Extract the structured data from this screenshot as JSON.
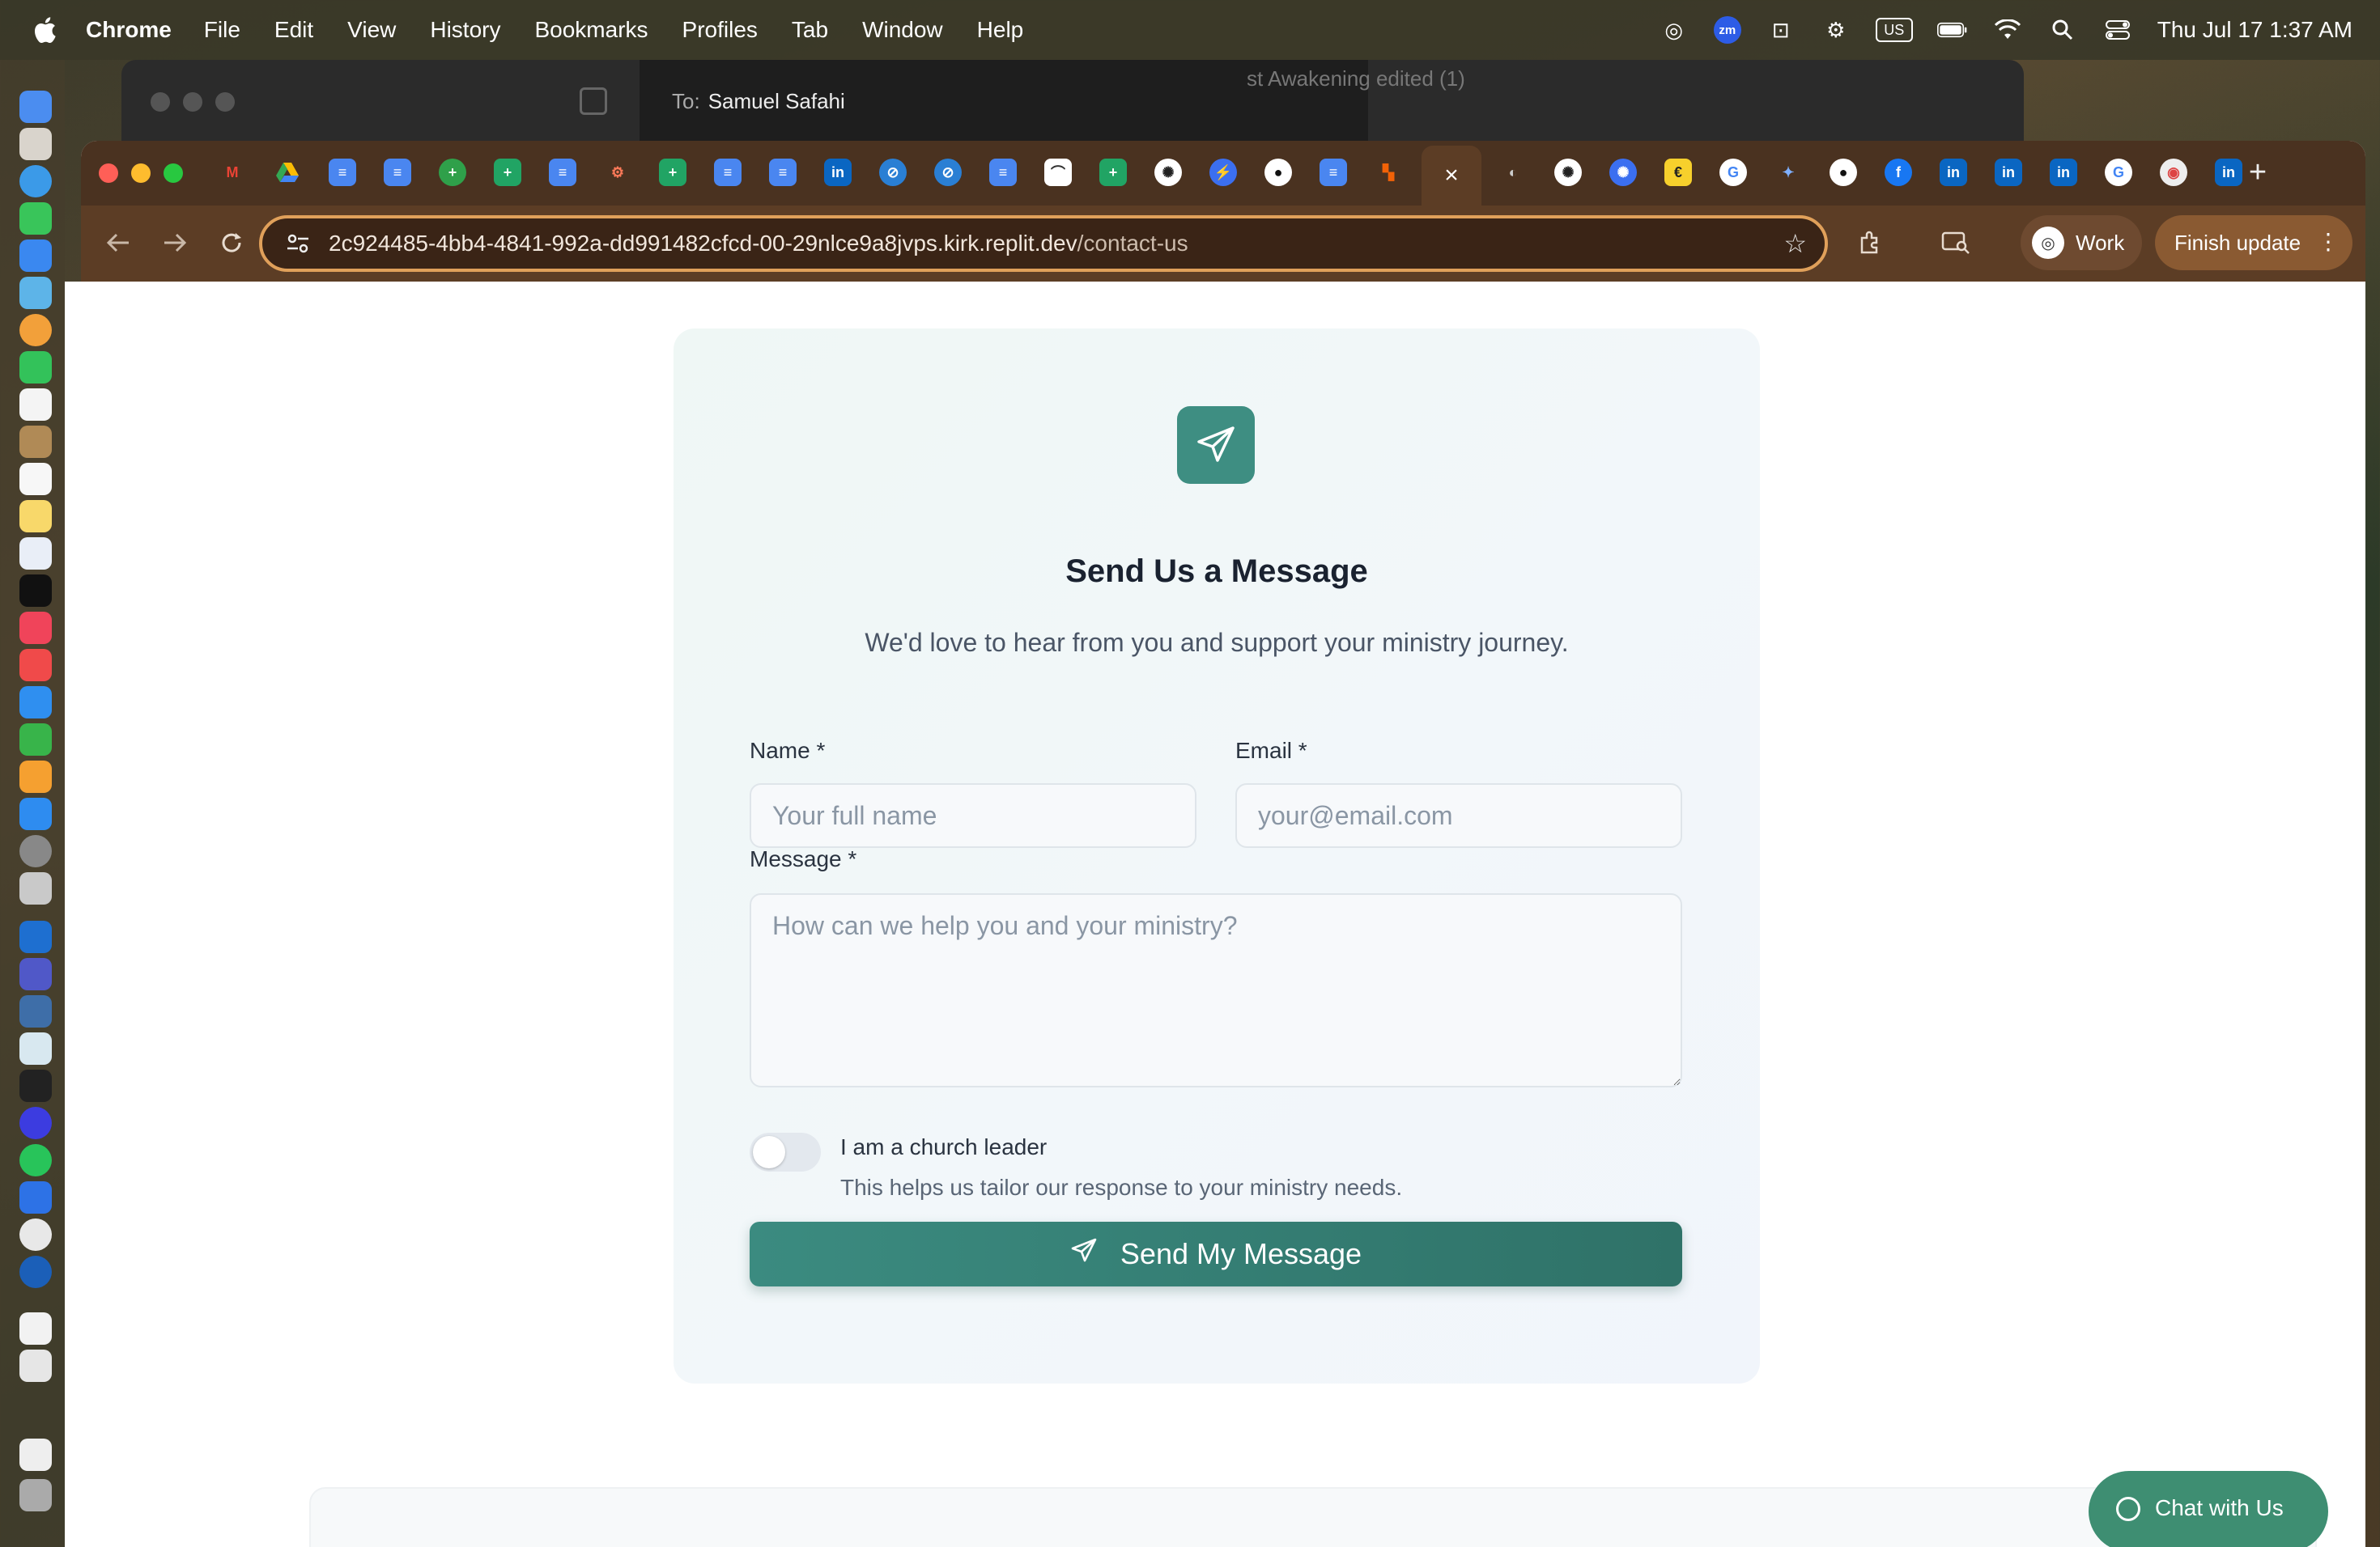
{
  "menubar": {
    "app_name": "Chrome",
    "menus": [
      "File",
      "Edit",
      "View",
      "History",
      "Bookmarks",
      "Profiles",
      "Tab",
      "Window",
      "Help"
    ],
    "input_source": "US",
    "zoom_badge": "zm",
    "clock": "Thu Jul 17  1:37 AM"
  },
  "background_window": {
    "to_label": "To:",
    "recipient": "Samuel Safahi",
    "doc_title": "st Awakening edited (1)"
  },
  "browser": {
    "active_tab_close": "×",
    "new_tab": "+",
    "url_host": "2c924485-4bb4-4841-992a-dd991482cfcd-00-29nlce9a8jvps.kirk.replit.dev",
    "url_path": "/contact-us",
    "profile_label": "Work",
    "update_label": "Finish update",
    "colors": {
      "frame": "#4a3220",
      "toolbar": "#5c3d25",
      "omnibox_border": "#e0a05a"
    }
  },
  "form": {
    "title": "Send Us a Message",
    "subtitle": "We'd love to hear from you and support your ministry journey.",
    "name_label": "Name *",
    "name_placeholder": "Your full name",
    "name_value": "",
    "email_label": "Email *",
    "email_placeholder": "your@email.com",
    "email_value": "",
    "message_label": "Message *",
    "message_placeholder": "How can we help you and your ministry?",
    "message_value": "",
    "church_leader_label": "I am a church leader",
    "church_leader_help": "This helps us tailor our response to your ministry needs.",
    "church_leader_checked": false,
    "submit_label": "Send My Message",
    "accent_color": "#3e8e82"
  },
  "chat": {
    "label": "Chat with Us",
    "color": "#3e8e72"
  }
}
